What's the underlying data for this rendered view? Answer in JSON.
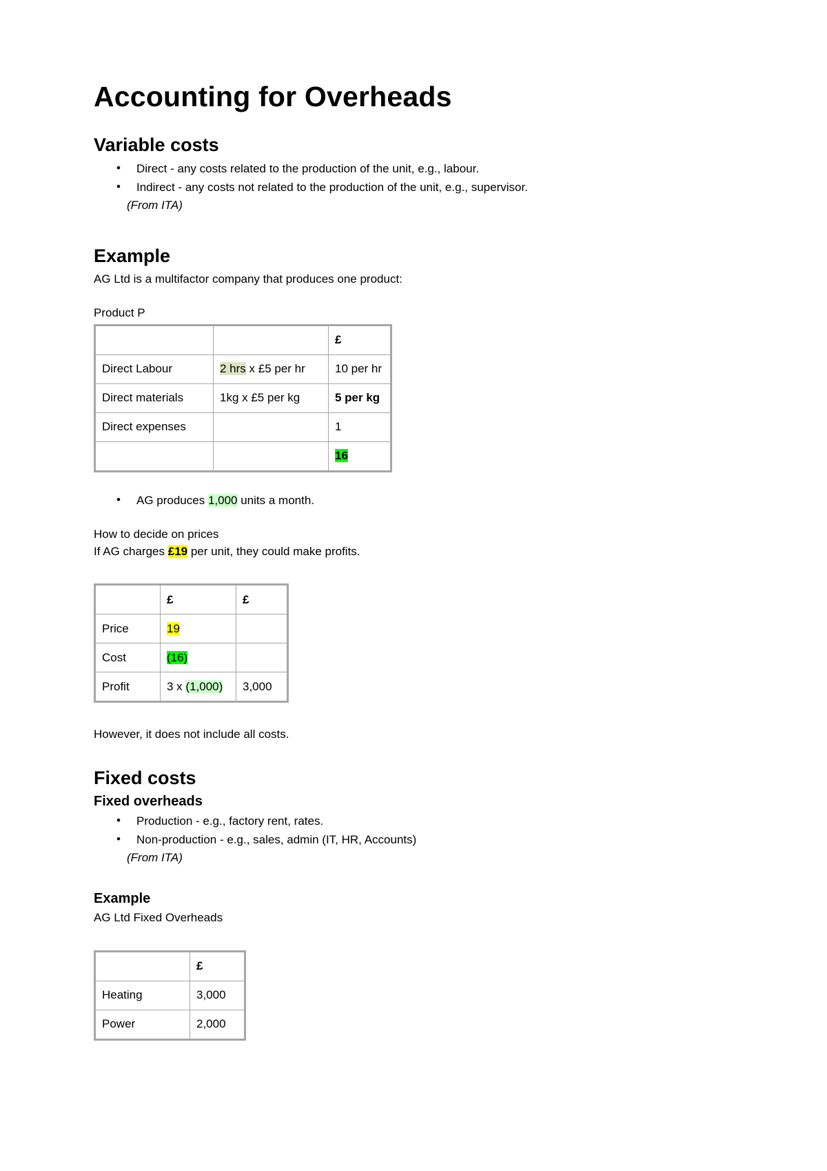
{
  "document": {
    "title": "Accounting for Overheads"
  },
  "sections": {
    "variable_costs": {
      "heading": "Variable costs",
      "bullets": [
        "Direct - any costs related to the production of the unit, e.g., labour.",
        "Indirect - any costs not related to the production of the unit, e.g., supervisor."
      ],
      "source_note": "(From ITA)"
    },
    "example_1": {
      "heading": "Example",
      "intro": "AG Ltd is a multifactor company that produces one product:",
      "table_caption": "Product P",
      "table": {
        "header": [
          "",
          "",
          "£"
        ],
        "rows": [
          {
            "label": "Direct Labour",
            "calc_prefix": "2 hrs",
            "calc_rest": " x £5 per hr",
            "amount": "10 per hr",
            "amount_bold": false
          },
          {
            "label": "Direct materials",
            "calc_prefix": "",
            "calc_rest": "1kg x £5 per kg",
            "amount": "5 per kg",
            "amount_bold": true
          },
          {
            "label": "Direct expenses",
            "calc_prefix": "",
            "calc_rest": "",
            "amount": "1",
            "amount_bold": false
          },
          {
            "label": "",
            "calc_prefix": "",
            "calc_rest": "",
            "amount": "16",
            "amount_bold": true
          }
        ]
      },
      "bullet_units": {
        "before": "AG produces ",
        "value": "1,000",
        "after": " units a month."
      }
    },
    "pricing": {
      "line_1": "How to decide on prices",
      "line_2_before": "If AG charges ",
      "line_2_value": "£19",
      "line_2_after": " per unit, they could make profits.",
      "table": {
        "header": [
          "",
          "£",
          "£"
        ],
        "rows": [
          {
            "label": "Price",
            "col2": "19",
            "col3": ""
          },
          {
            "label": "Cost",
            "col2": "(16)",
            "col3": ""
          },
          {
            "label": "Profit",
            "col2_prefix": "3 x ",
            "col2_value": "(1,000)",
            "col3": "3,000"
          }
        ]
      },
      "closing_note": "However, it does not include all costs."
    },
    "fixed_costs": {
      "heading": "Fixed costs",
      "subheading": "Fixed overheads",
      "bullets": [
        "Production - e.g., factory rent, rates.",
        "Non-production - e.g., sales, admin (IT, HR, Accounts)"
      ],
      "source_note": "(From ITA)"
    },
    "example_2": {
      "heading": "Example",
      "intro": "AG Ltd Fixed Overheads",
      "table": {
        "header": [
          "",
          "£"
        ],
        "rows": [
          {
            "label": "Heating",
            "amount": "3,000"
          },
          {
            "label": "Power",
            "amount": "2,000"
          }
        ]
      }
    }
  },
  "colors": {
    "highlight_yellow": "#ffff00",
    "highlight_green": "#00ff00",
    "highlight_light_green": "#ccffcc",
    "highlight_olive": "#dde5c4",
    "table_border": "#a6a6a6",
    "text": "#000000",
    "page_background": "#ffffff"
  }
}
